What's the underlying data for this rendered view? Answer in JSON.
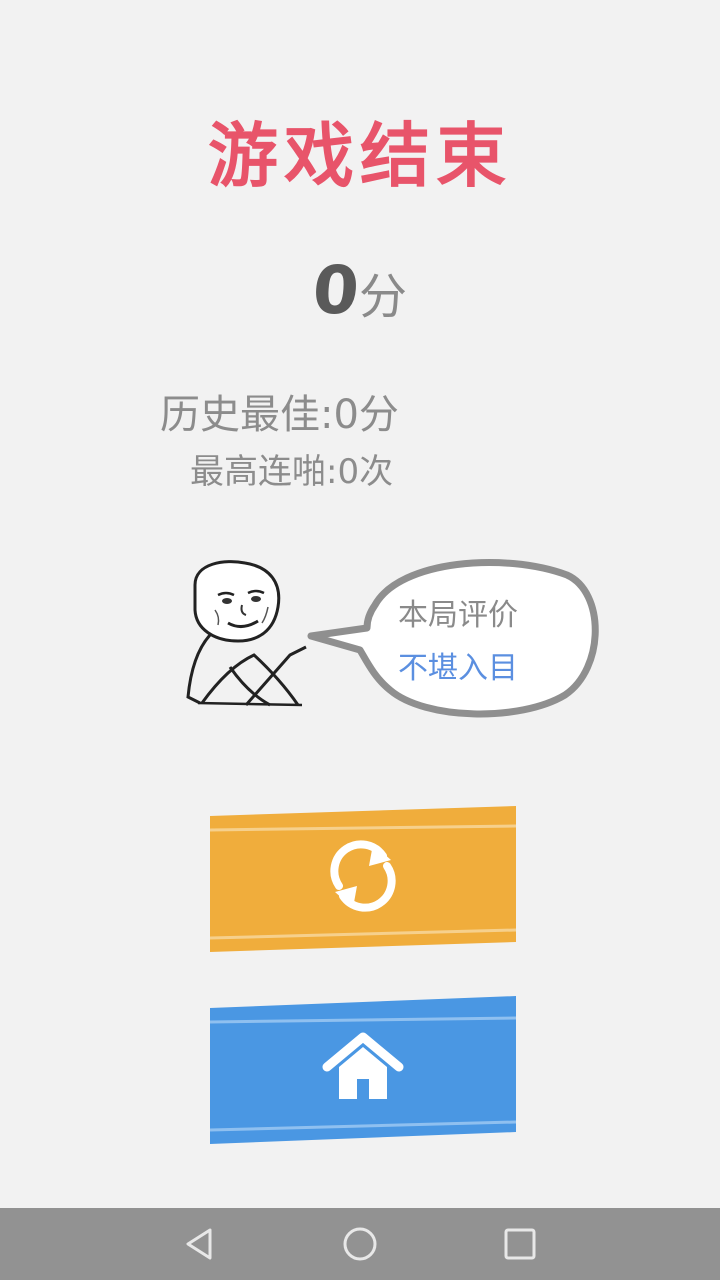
{
  "title": "游戏结束",
  "score": {
    "value": "0",
    "unit": "分"
  },
  "best_score": "历史最佳:0分",
  "best_combo": "最高连啪:0次",
  "evaluation": {
    "label": "本局评价",
    "value": "不堪入目"
  },
  "colors": {
    "title": "#e8546a",
    "restart_button": "#f0ad3c",
    "home_button": "#4a97e3",
    "evaluation_value": "#5b8fe0",
    "nav_bar": "#929292"
  },
  "buttons": {
    "restart": {
      "icon": "refresh-icon"
    },
    "home": {
      "icon": "home-icon"
    }
  },
  "nav": {
    "icons": [
      "back-icon",
      "home-circle-icon",
      "recents-icon"
    ]
  }
}
